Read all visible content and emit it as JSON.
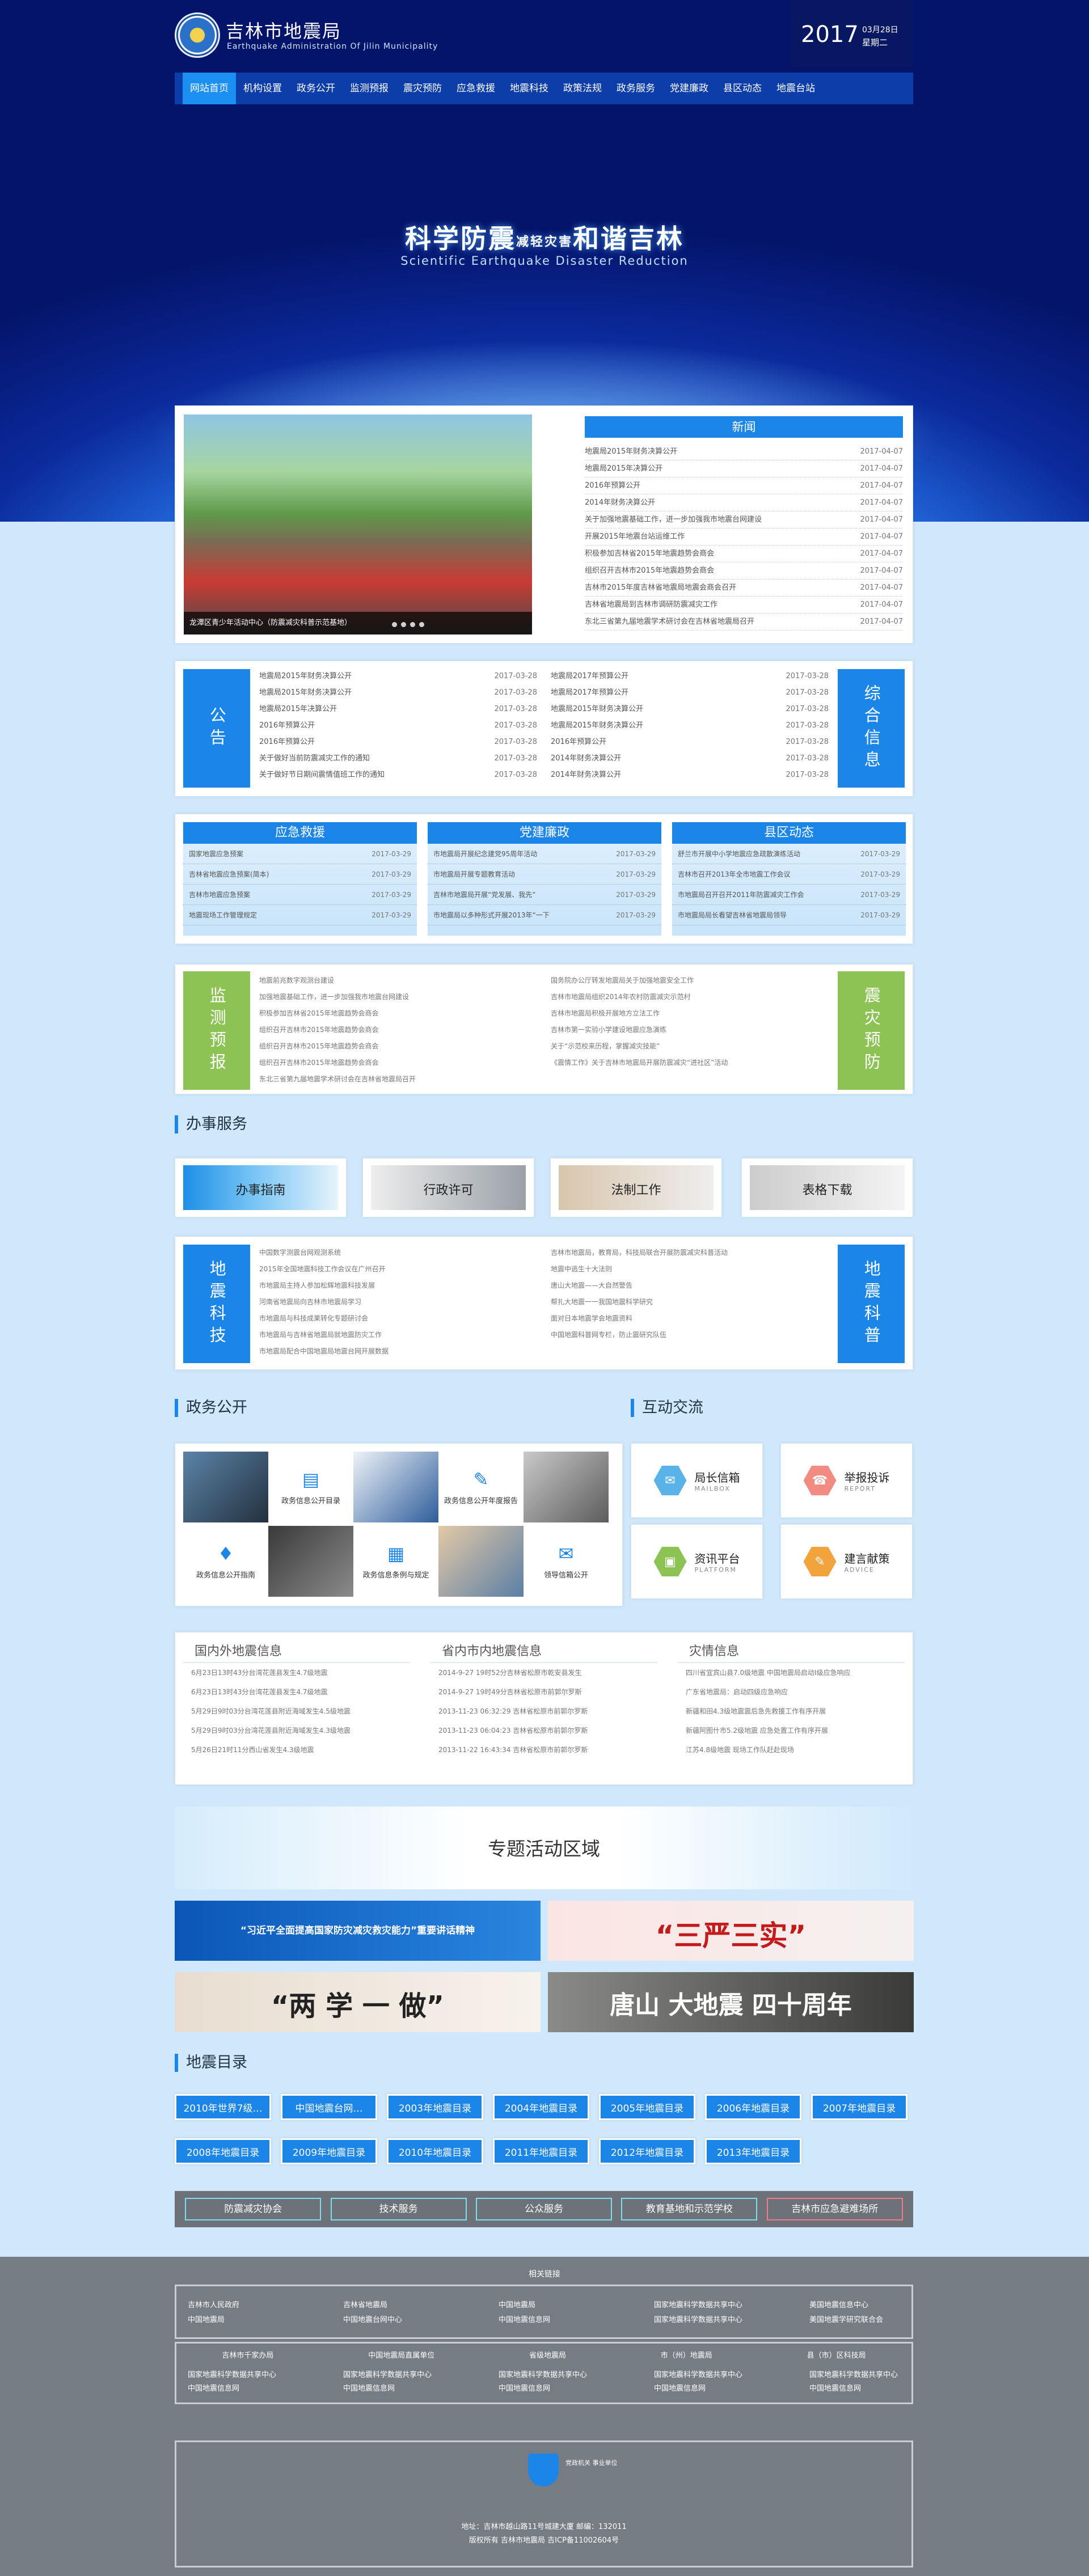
{
  "header": {
    "title": "吉林市地震局",
    "subtitle": "Earthquake Administration Of Jilin Municipality",
    "year": "2017",
    "month_day": "03月28日",
    "weekday": "星期二"
  },
  "nav": [
    "网站首页",
    "机构设置",
    "政务公开",
    "监测预报",
    "震灾预防",
    "应急救援",
    "地震科技",
    "政策法规",
    "政务服务",
    "党建廉政",
    "县区动态",
    "地震台站"
  ],
  "hero": {
    "slogan_a": "科学防震",
    "slogan_small": "减轻灾害",
    "slogan_b": "和谐吉林",
    "slogan_en": "Scientific Earthquake Disaster Reduction"
  },
  "news": {
    "heading": "新闻",
    "photo_caption": "龙潭区青少年活动中心（防震减灾科普示范基地）",
    "items": [
      {
        "t": "地震局2015年财务决算公开",
        "d": "2017-04-07"
      },
      {
        "t": "地震局2015年决算公开",
        "d": "2017-04-07"
      },
      {
        "t": "2016年预算公开",
        "d": "2017-04-07"
      },
      {
        "t": "2014年财务决算公开",
        "d": "2017-04-07"
      },
      {
        "t": "关于加强地震基础工作，进一步加强我市地震台网建设",
        "d": "2017-04-07"
      },
      {
        "t": "开展2015年地震台站运维工作",
        "d": "2017-04-07"
      },
      {
        "t": "积极参加吉林省2015年地震趋势会商会",
        "d": "2017-04-07"
      },
      {
        "t": "组织召开吉林市2015年地震趋势会商会",
        "d": "2017-04-07"
      },
      {
        "t": "吉林市2015年度吉林省地震局地震会商会召开",
        "d": "2017-04-07"
      },
      {
        "t": "吉林省地震局到吉林市调研防震减灾工作",
        "d": "2017-04-07"
      },
      {
        "t": "东北三省第九届地震学术研讨会在吉林省地震局召开",
        "d": "2017-04-07"
      }
    ]
  },
  "notice": {
    "left_label": "公告",
    "right_label": "综合信息",
    "col1": [
      {
        "t": "地震局2015年财务决算公开",
        "d": "2017-03-28"
      },
      {
        "t": "地震局2015年财务决算公开",
        "d": "2017-03-28"
      },
      {
        "t": "地震局2015年决算公开",
        "d": "2017-03-28"
      },
      {
        "t": "2016年预算公开",
        "d": "2017-03-28"
      },
      {
        "t": "2016年预算公开",
        "d": "2017-03-28"
      },
      {
        "t": "关于做好当前防震减灾工作的通知",
        "d": "2017-03-28"
      },
      {
        "t": "关于做好节日期间震情值班工作的通知",
        "d": "2017-03-28"
      }
    ],
    "col2": [
      {
        "t": "地震局2017年预算公开",
        "d": "2017-03-28"
      },
      {
        "t": "地震局2017年预算公开",
        "d": "2017-03-28"
      },
      {
        "t": "地震局2015年财务决算公开",
        "d": "2017-03-28"
      },
      {
        "t": "地震局2015年财务决算公开",
        "d": "2017-03-28"
      },
      {
        "t": "2016年预算公开",
        "d": "2017-03-28"
      },
      {
        "t": "2014年财务决算公开",
        "d": "2017-03-28"
      },
      {
        "t": "2014年财务决算公开",
        "d": "2017-03-28"
      }
    ]
  },
  "three": [
    {
      "head": "应急救援",
      "items": [
        {
          "t": "国家地震应急预案",
          "d": "2017-03-29"
        },
        {
          "t": "吉林省地震应急预案(简本)",
          "d": "2017-03-29"
        },
        {
          "t": "吉林市地震应急预案",
          "d": "2017-03-29"
        },
        {
          "t": "地震现场工作管理规定",
          "d": "2017-03-29"
        }
      ]
    },
    {
      "head": "党建廉政",
      "items": [
        {
          "t": "市地震局开展纪念建党95周年活动",
          "d": "2017-03-29"
        },
        {
          "t": "市地震局开展专题教育活动",
          "d": "2017-03-29"
        },
        {
          "t": "吉林市地震局开展“党发展、我先”",
          "d": "2017-03-29"
        },
        {
          "t": "市地震局以多种形式开展2013年“一下",
          "d": "2017-03-29"
        }
      ]
    },
    {
      "head": "县区动态",
      "items": [
        {
          "t": "舒兰市开展中小学地震应急疏散演练活动",
          "d": "2017-03-29"
        },
        {
          "t": "吉林市召开2013年全市地震工作会议",
          "d": "2017-03-29"
        },
        {
          "t": "市地震局召开召开2011年防震减灾工作会",
          "d": "2017-03-29"
        },
        {
          "t": "市地震局局长看望吉林省地震局领导",
          "d": "2017-03-29"
        }
      ]
    }
  ],
  "monitor": {
    "left_label": "监测预报",
    "right_label": "震灾预防",
    "col1": [
      "地震前兆数字观测台建设",
      "加强地震基础工作，进一步加强我市地震台网建设",
      "积极参加吉林省2015年地震趋势会商会",
      "组织召开吉林市2015年地震趋势会商会",
      "组织召开吉林市2015年地震趋势会商会",
      "组织召开吉林市2015年地震趋势会商会",
      "东北三省第九届地震学术研讨会在吉林省地震局召开"
    ],
    "col2": [
      "国务院办公厅转发地震局关于加强地震安全工作",
      "吉林市地震局组织2014年农村防震减灾示范村",
      "吉林市地震局积极开展地方立法工作",
      "吉林市第一实验小学建设地震应急演练",
      "关于“示范校来历程，掌握减灾技能”",
      "《震情工作》关于吉林市地震局开展防震减灾“进社区”活动"
    ]
  },
  "services": {
    "title": "办事服务",
    "items": [
      "办事指南",
      "行政许可",
      "法制工作",
      "表格下载"
    ]
  },
  "science": {
    "left_label": "地震科技",
    "right_label": "地震科普",
    "col1": [
      "中国数字测震台网观测系统",
      "2015年全国地震科技工作会议在广州召开",
      "市地震局主持人参加松辉地震科技发展",
      "河南省地震局向吉林市地震局学习",
      "市地震局与科技成果转化专题研讨会",
      "市地震局与吉林省地震局就地震防灾工作",
      "市地震局配合中国地震局地震台网开展数据"
    ],
    "col2": [
      "吉林市地震局，教育局，科技局联合开展防震减灾科普活动",
      "地震中逃生十大法则",
      "唐山大地震——大自然警告",
      "帮扎大地震一一我国地震科学研究",
      "面对日本地震学会地震资料",
      "中国地震科普网专栏，防止震研究队伍"
    ]
  },
  "gov": {
    "title": "政务公开",
    "cells": [
      "政务信息公开目录",
      "政务信息公开年度报告",
      "政务信息公开指南",
      "政务信息条例与规定",
      "领导信箱公开"
    ]
  },
  "interact": {
    "title": "互动交流",
    "items": [
      {
        "t": "局长信箱",
        "s": "MAILBOX",
        "c": "#5ab3e8",
        "i": "✉"
      },
      {
        "t": "举报投诉",
        "s": "REPORT",
        "c": "#f28b82",
        "i": "☎"
      },
      {
        "t": "资讯平台",
        "s": "PLATFORM",
        "c": "#8dc354",
        "i": "▣"
      },
      {
        "t": "建言献策",
        "s": "ADVICE",
        "c": "#f2a33b",
        "i": "✎"
      }
    ]
  },
  "quake_info": [
    {
      "head": "国内外地震信息",
      "items": [
        "6月23日13时43分台湾花莲县发生4.7级地震",
        "6月23日13时43分台湾花莲县发生4.7级地震",
        "5月29日9时03分台湾花莲县附近海域发生4.5级地震",
        "5月29日9时03分台湾花莲县附近海域发生4.3级地震",
        "5月26日21时11分西山省发生4.3级地震"
      ]
    },
    {
      "head": "省内市内地震信息",
      "items": [
        "2014-9-27 19时52分吉林省松原市乾安县发生",
        "2014-9-27 19时49分吉林省松原市前郭尔罗斯",
        "2013-11-23 06:32:29 吉林省松原市前郭尔罗斯",
        "2013-11-23 06:04:23 吉林省松原市前郭尔罗斯",
        "2013-11-22 16:43:34 吉林省松原市前郭尔罗斯"
      ]
    },
    {
      "head": "灾情信息",
      "items": [
        "四川省宜宾山县7.0级地震 中国地震局启动Ⅰ级应急响应",
        "广东省地震局：启动四级应急响应",
        "新疆和田4.3级地震震后急先救援工作有序开展",
        "新疆阿图什市5.2级地震 应急处置工作有序开展",
        "江苏4.8级地震 现场工作队赶赴现场"
      ]
    }
  ],
  "special": {
    "title": "专题活动区域",
    "b1": "“习近平全面提高国家防灾减灾救灾能力”重要讲话精神",
    "b2": "“三严三实”",
    "b3": "“两 学 一 做”",
    "b4": "唐山 大地震 四十周年"
  },
  "directory": {
    "title": "地震目录",
    "items": [
      "2010年世界7级…",
      "中国地震台网…",
      "2003年地震目录",
      "2004年地震目录",
      "2005年地震目录",
      "2006年地震目录",
      "2007年地震目录",
      "2008年地震目录",
      "2009年地震目录",
      "2010年地震目录",
      "2011年地震目录",
      "2012年地震目录",
      "2013年地震目录"
    ]
  },
  "bar5": [
    "防震减灾协会",
    "技术服务",
    "公众服务",
    "教育基地和示范学校",
    "吉林市应急避难场所"
  ],
  "footer": {
    "links_title": "相关链接",
    "links1": [
      "吉林市人民政府",
      "吉林省地震局",
      "中国地震局",
      "国家地震科学数据共享中心",
      "美国地震信息中心",
      "中国地震局",
      "中国地震台网中心",
      "中国地震信息网",
      "国家地震科学数据共享中心",
      "美国地震学研究联合会"
    ],
    "tabs": [
      "吉林市千家办局",
      "中国地震局直属单位",
      "省级地震局",
      "市（州）地震局",
      "县（市）区科技局"
    ],
    "links2": [
      "国家地震科学数据共享中心",
      "国家地震科学数据共享中心",
      "国家地震科学数据共享中心",
      "国家地震科学数据共享中心",
      "国家地震科学数据共享中心",
      "中国地震信息网",
      "中国地震信息网",
      "中国地震信息网",
      "中国地震信息网",
      "中国地震信息网"
    ],
    "badge": "党政机关 事业单位",
    "copy1": "地址：吉林市越山路11号城建大厦  邮编：132011",
    "copy2": "版权所有 吉林市地震局  吉ICP备11002604号"
  }
}
